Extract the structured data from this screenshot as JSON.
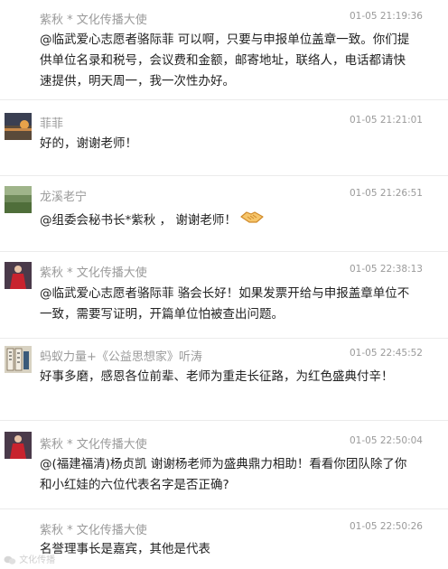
{
  "messages": [
    {
      "name": "紫秋 * 文化传播大使",
      "time": "01-05 21:19:36",
      "text": "@临武爱心志愿者骆际菲 可以啊，只要与申报单位盖章一致。你们提供单位名录和税号，会议费和金额，邮寄地址，联络人，电话都请快速提供，明天周一，我一次性办好。",
      "avatar": "none"
    },
    {
      "name": "菲菲",
      "time": "01-05 21:21:01",
      "text": "好的，谢谢老师！",
      "avatar": "sunset-photo"
    },
    {
      "name": "龙溪老宁",
      "time": "01-05 21:26:51",
      "text": "@组委会秘书长*紫秋 ， 谢谢老师！",
      "avatar": "green-field-photo",
      "emoji": "handshake-icon"
    },
    {
      "name": "紫秋 * 文化传播大使",
      "time": "01-05 22:38:13",
      "text": "@临武爱心志愿者骆际菲 骆会长好！如果发票开给与申报盖章单位不一致，需要写证明，开篇单位怕被查出问题。",
      "avatar": "portrait-red-dress"
    },
    {
      "name": "蚂蚁力量+《公益思想家》听涛",
      "time": "01-05 22:45:52",
      "text": "好事多磨，感恩各位前辈、老师为重走长征路，为红色盛典付辛！",
      "avatar": "calligraphy-photo"
    },
    {
      "name": "紫秋 * 文化传播大使",
      "time": "01-05 22:50:04",
      "text": "@(福建福清)杨贞凯 谢谢杨老师为盛典鼎力相助！看看你团队除了你和小红娃的六位代表名字是否正确?",
      "avatar": "portrait-red-dress"
    },
    {
      "name": "紫秋 * 文化传播大使",
      "time": "01-05 22:50:26",
      "text": "名誉理事长是嘉宾，其他是代表",
      "avatar": "none"
    }
  ],
  "watermark": "文化传播"
}
